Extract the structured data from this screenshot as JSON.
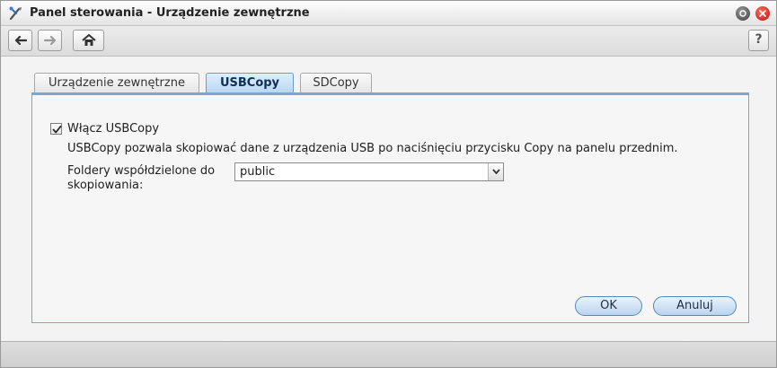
{
  "window": {
    "title": "Panel sterowania - Urządzenie zewnętrzne",
    "icons": [
      "control-panel-icon",
      "minimize-icon",
      "close-icon"
    ]
  },
  "toolbar": {
    "icons": [
      "back-arrow-icon",
      "forward-arrow-icon",
      "home-icon",
      "help-icon"
    ],
    "help_label": "?"
  },
  "tabs": [
    {
      "label": "Urządzenie zewnętrzne",
      "active": false
    },
    {
      "label": "USBCopy",
      "active": true
    },
    {
      "label": "SDCopy",
      "active": false
    }
  ],
  "form": {
    "enable_label": "Włącz USBCopy",
    "enable_checked": true,
    "description": "USBCopy pozwala skopiować dane z urządzenia USB po naciśnięciu przycisku Copy na panelu przednim.",
    "folder_label": "Foldery współdzielone do skopiowania:",
    "folder_value": "public"
  },
  "buttons": {
    "ok_label": "OK",
    "cancel_label": "Anuluj"
  },
  "colors": {
    "accent": "#7ea6cc",
    "active_tab": "#b7d6f3",
    "close": "#c4100a"
  }
}
